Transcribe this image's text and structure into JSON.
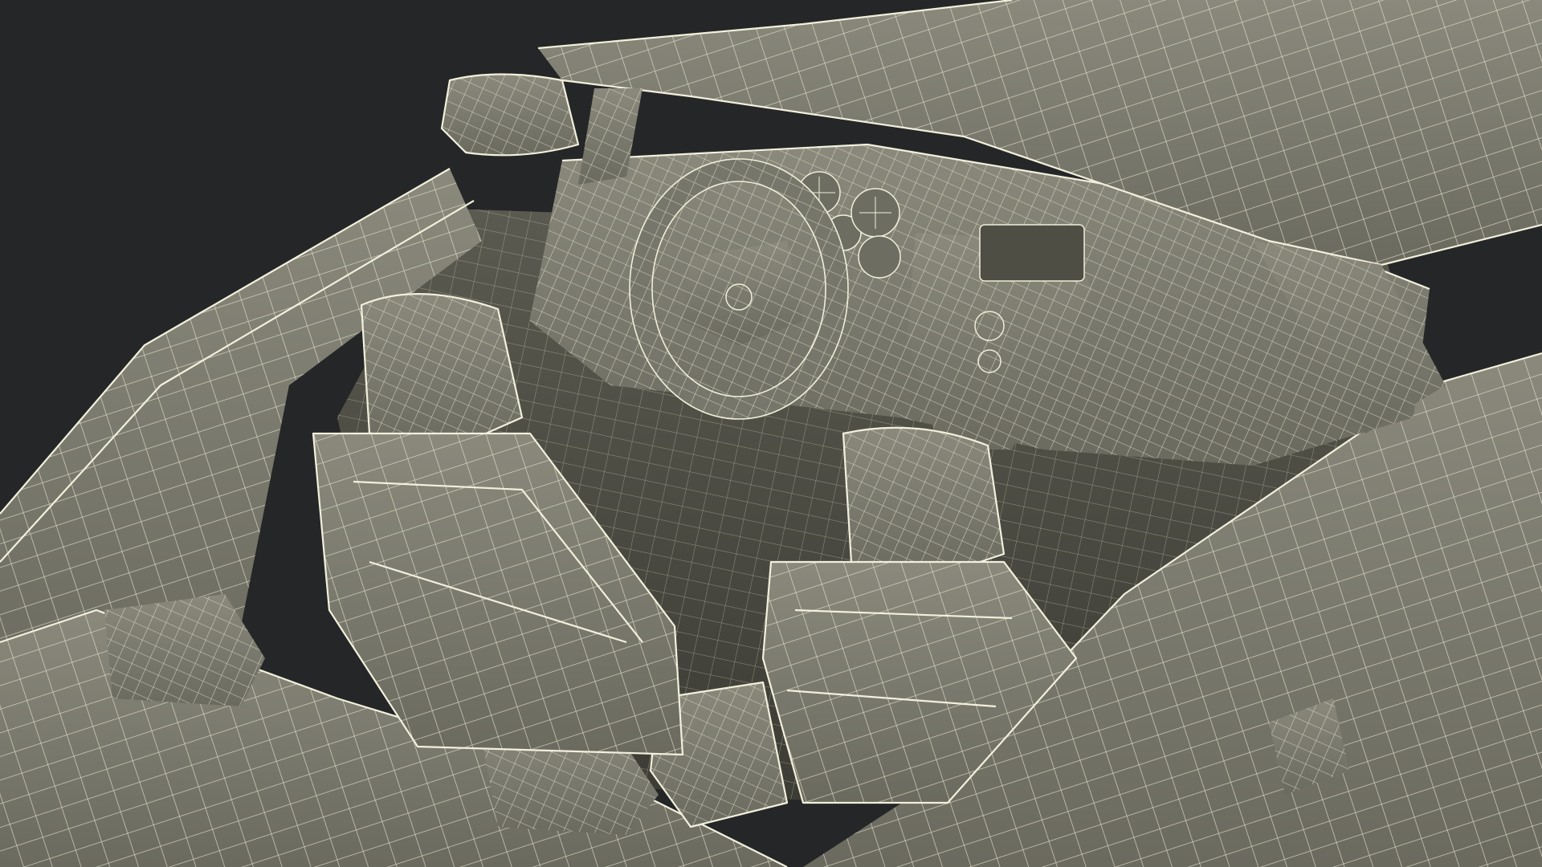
{
  "scene": {
    "background_color": "#252627",
    "surface_color": "#7d7c70",
    "surface_shadow_color": "#3f3f38",
    "wire_color": "#f2f0dc"
  },
  "objects": [
    {
      "name": "windshield-frame",
      "icon": "wireframe-mesh"
    },
    {
      "name": "rearview-mirror",
      "icon": "wireframe-mesh"
    },
    {
      "name": "dashboard",
      "icon": "wireframe-mesh"
    },
    {
      "name": "steering-wheel",
      "icon": "wireframe-mesh"
    },
    {
      "name": "instrument-cluster",
      "icon": "wireframe-mesh"
    },
    {
      "name": "center-console",
      "icon": "wireframe-mesh"
    },
    {
      "name": "driver-seat",
      "icon": "wireframe-mesh"
    },
    {
      "name": "passenger-seat",
      "icon": "wireframe-mesh"
    },
    {
      "name": "left-door",
      "icon": "wireframe-mesh"
    },
    {
      "name": "right-door",
      "icon": "wireframe-mesh"
    },
    {
      "name": "rear-deck",
      "icon": "wireframe-mesh"
    }
  ]
}
